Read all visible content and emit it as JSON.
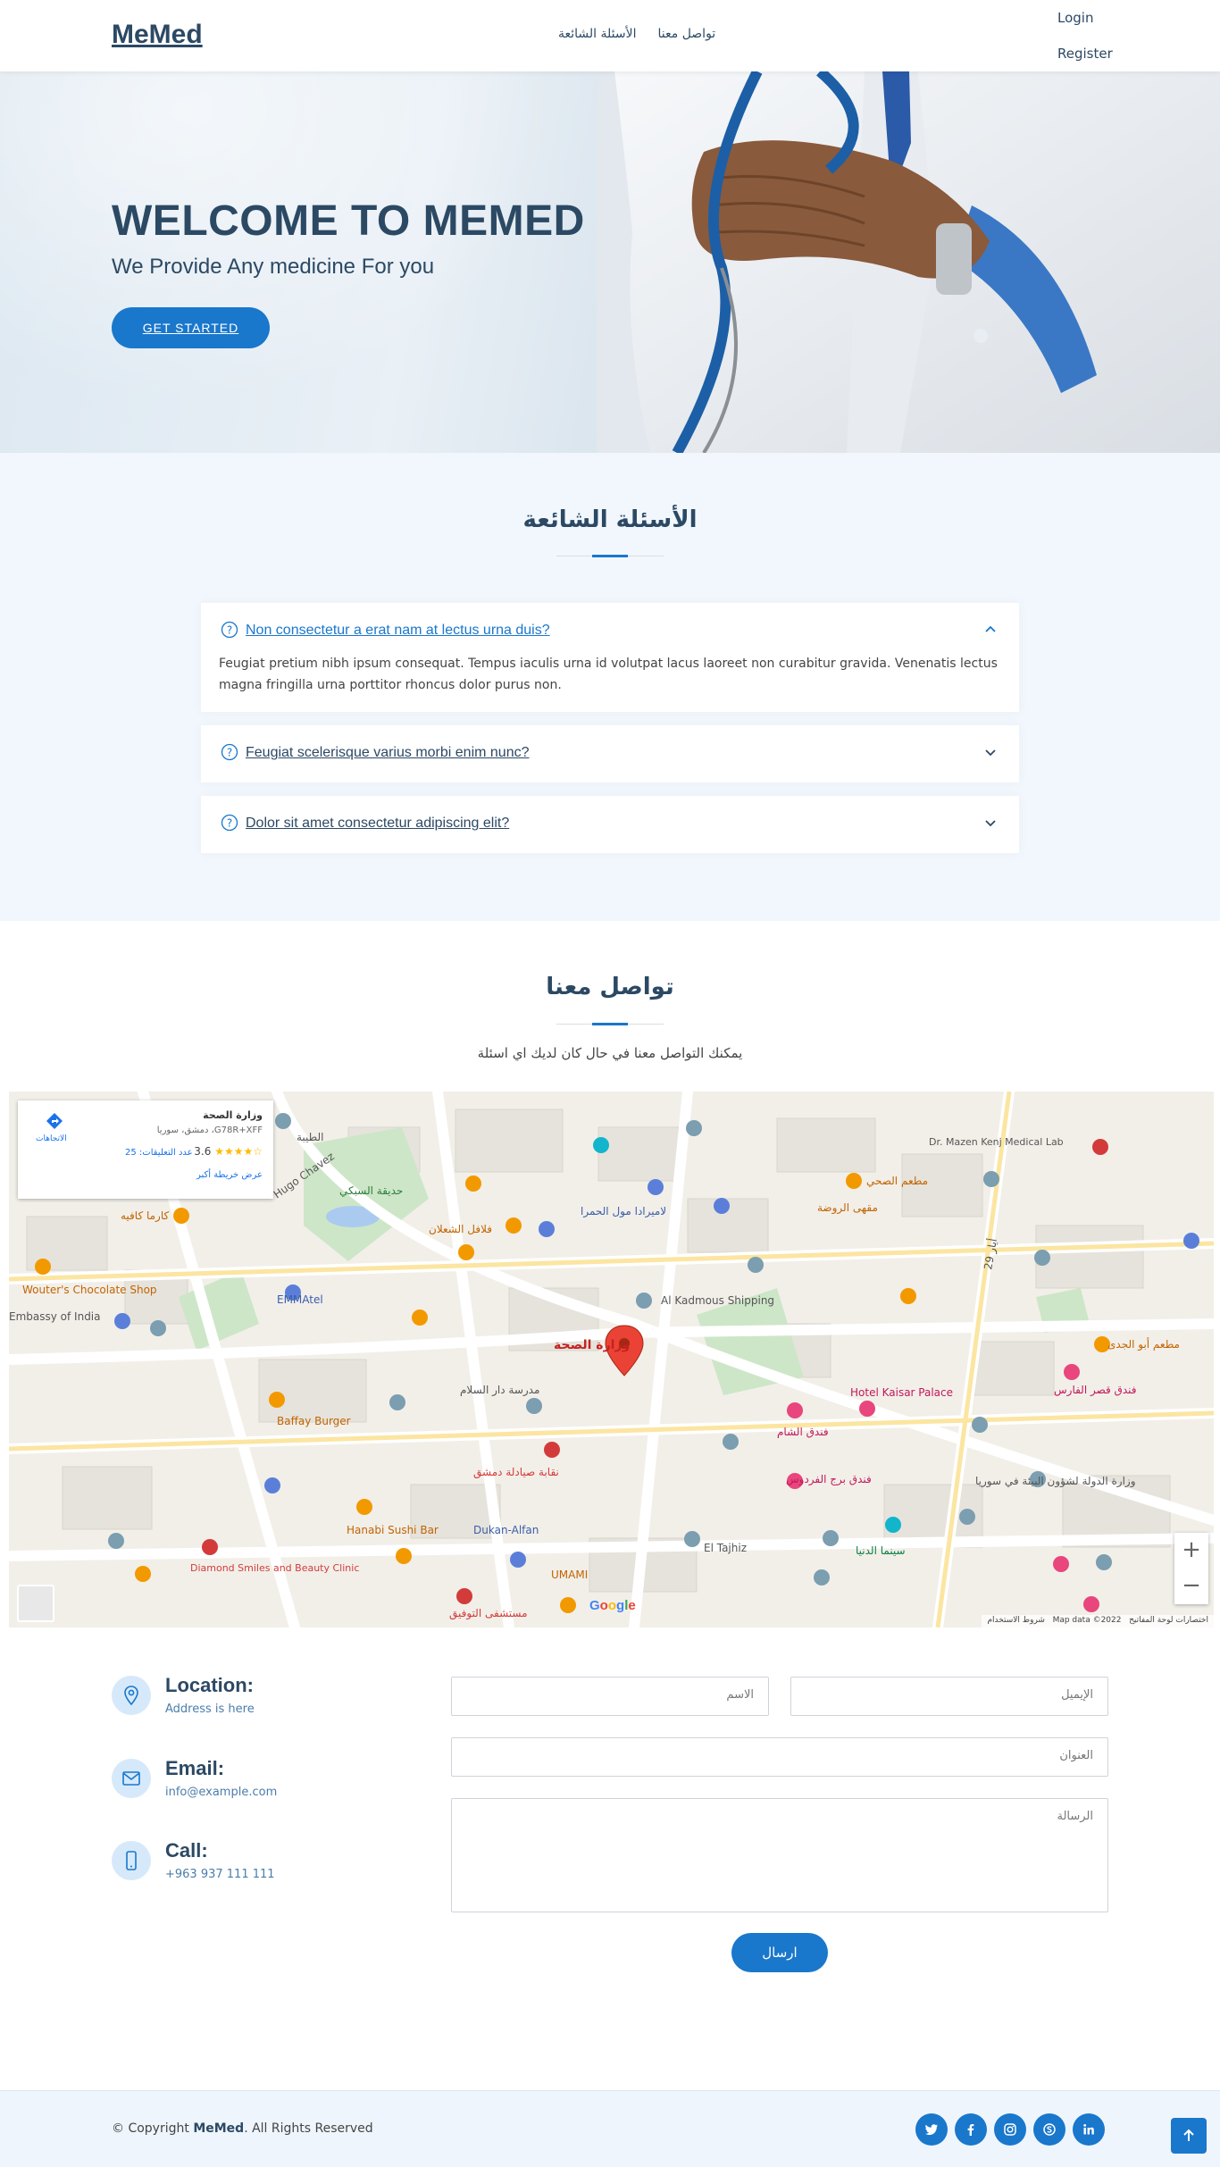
{
  "header": {
    "logo": "MeMed",
    "nav": [
      "تواصل معنا",
      "الأسئلة الشائعة"
    ],
    "login": "Login",
    "register": "Register"
  },
  "hero": {
    "title": "WELCOME TO MEMED",
    "subtitle": "We Provide Any medicine For you",
    "cta": "GET STARTED"
  },
  "faq": {
    "title": "الأسئلة الشائعة",
    "items": [
      {
        "question": "Non consectetur a erat nam at lectus urna duis?",
        "answer": "Feugiat pretium nibh ipsum consequat. Tempus iaculis urna id volutpat lacus laoreet non curabitur gravida. Venenatis lectus magna fringilla urna porttitor rhoncus dolor purus non.",
        "expanded": true
      },
      {
        "question": "Feugiat scelerisque varius morbi enim nunc?",
        "expanded": false
      },
      {
        "question": "Dolor sit amet consectetur adipiscing elit?",
        "expanded": false
      }
    ]
  },
  "contact": {
    "title": "تواصل معنا",
    "subtitle": "يمكنك التواصل معنا في حال كان لديك اي اسئلة",
    "map": {
      "place_name": "وزارة الصحة",
      "place_code": "G78R+XFF، دمشق، سوريا",
      "rating": "3.6",
      "reviews": "عدد التعليقات: 25",
      "bigger_map": "عرض خريطة أكبر",
      "directions": "الاتجاهات",
      "pin_label": "وزارة الصحة",
      "footer_data": "Map data ©2022",
      "footer_shortcuts": "اختصارات لوحة المفاتيح",
      "footer_terms": "شروط الاستخدام",
      "google": "Google",
      "labels": {
        "l1": "الطيبة",
        "l2": "Hugo Chavez",
        "l3": "حديقة السبكي",
        "l4": "فلافل الشعلان",
        "l5": "لاميرادا مول الحمرا",
        "l6": "مطعم الصحي",
        "l7": "مقهى الروضة",
        "l8": "Al Kadmous Shipping",
        "l9": "Hotel Kaisar Palace",
        "l10": "فندق الشام",
        "l11": "Wouter's Chocolate Shop",
        "l12": "Baffay Burger",
        "l13": "Hanabi Sushi Bar",
        "l14": "Dukan-Alfan",
        "l15": "El Tajhiz",
        "l16": "Diamond Smiles and Beauty Clinic",
        "l17": "UMAMI",
        "l18": "فندق برج الفردوس",
        "l19": "فندق قصر الفارس",
        "l20": "مطعم أبو الجدى",
        "l21": "Dr. Mazen Kenj Medical Lab",
        "l22": "مستشفى التوفيق",
        "l23": "29 أيار",
        "l24": "Embassy of India",
        "l25": "كارما كافيه",
        "l26": "EMMAtel",
        "l27": "نقابة صيادلة دمشق",
        "l28": "وزارة الدولة لشؤون البيئة في سوريا",
        "l29": "سينما الدنيا",
        "l30": "مدرسة دار السلام"
      }
    },
    "location": {
      "title": "Location:",
      "value": "Address is here"
    },
    "email": {
      "title": "Email:",
      "value": "info@example.com"
    },
    "call": {
      "title": "Call:",
      "value": "+963 937 111 111"
    },
    "form": {
      "name_placeholder": "الاسم",
      "email_placeholder": "الإيميل",
      "subject_placeholder": "العنوان",
      "message_placeholder": "الرسالة",
      "submit": "ارسال"
    }
  },
  "footer": {
    "copyright_prefix": "© Copyright",
    "copyright_brand": "MeMed",
    "copyright_suffix": ". All Rights Reserved",
    "socials": [
      "twitter-icon",
      "facebook-icon",
      "instagram-icon",
      "skype-icon",
      "linkedin-icon"
    ]
  },
  "colors": {
    "primary": "#1977cc",
    "heading": "#2c4964",
    "faq_bg": "#f1f7fd"
  }
}
